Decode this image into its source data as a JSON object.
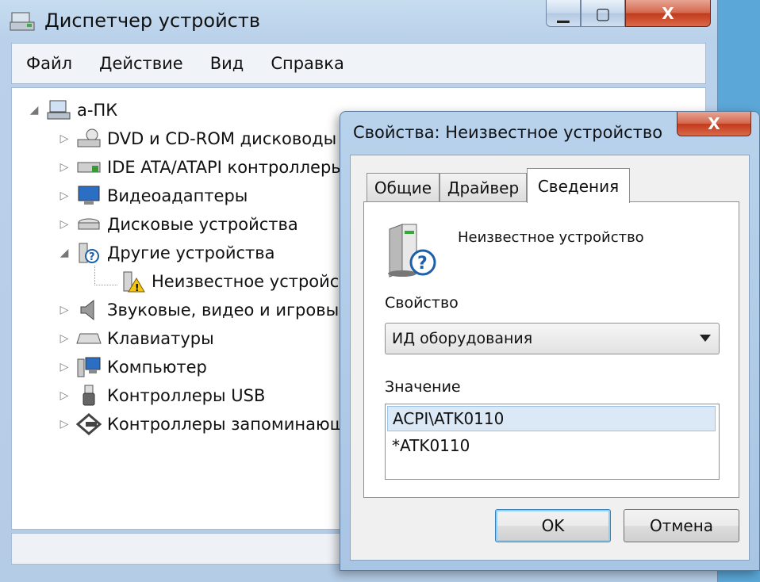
{
  "window": {
    "title": "Диспетчер устройств",
    "minimize_glyph": "▁",
    "maximize_glyph": "▢",
    "close_glyph": "X"
  },
  "menu": [
    "Файл",
    "Действие",
    "Вид",
    "Справка"
  ],
  "tree": {
    "root": {
      "label": "а-ПК",
      "expander": "◢",
      "icon": "computer-icon"
    },
    "nodes": [
      {
        "label": "DVD и CD-ROM дисководы",
        "expander": "▷",
        "icon": "dvd-drive-icon"
      },
      {
        "label": "IDE ATA/ATAPI контроллеры",
        "expander": "▷",
        "icon": "ide-controller-icon"
      },
      {
        "label": "Видеоадаптеры",
        "expander": "▷",
        "icon": "monitor-icon"
      },
      {
        "label": "Дисковые устройства",
        "expander": "▷",
        "icon": "disk-drive-icon"
      },
      {
        "label": "Другие устройства",
        "expander": "◢",
        "icon": "unknown-device-icon"
      },
      {
        "label": "Неизвестное устройство",
        "expander": "",
        "icon": "warning-device-icon"
      },
      {
        "label": "Звуковые, видео и игровые устройства",
        "expander": "▷",
        "icon": "speaker-icon"
      },
      {
        "label": "Клавиатуры",
        "expander": "▷",
        "icon": "keyboard-icon"
      },
      {
        "label": "Компьютер",
        "expander": "▷",
        "icon": "computer-icon"
      },
      {
        "label": "Контроллеры USB",
        "expander": "▷",
        "icon": "usb-icon"
      },
      {
        "label": "Контроллеры запоминающих устройств",
        "expander": "▷",
        "icon": "storage-controller-icon"
      }
    ]
  },
  "dialog": {
    "title": "Свойства: Неизвестное устройство",
    "close_glyph": "X",
    "tabs": [
      "Общие",
      "Драйвер",
      "Сведения"
    ],
    "active_tab": "Сведения",
    "device_name": "Неизвестное устройство",
    "property_label": "Свойство",
    "property_value": "ИД оборудования",
    "value_label": "Значение",
    "values": [
      "ACPI\\ATK0110",
      "*ATK0110"
    ],
    "ok_label": "OK",
    "cancel_label": "Отмена"
  }
}
